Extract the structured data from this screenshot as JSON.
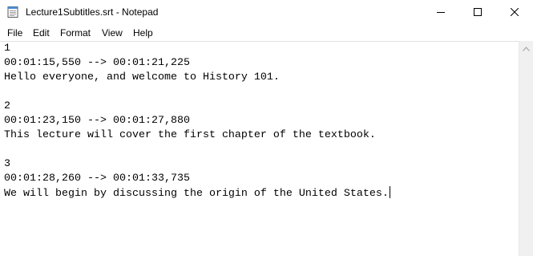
{
  "window": {
    "title": "Lecture1Subtitles.srt - Notepad"
  },
  "menu": {
    "file": "File",
    "edit": "Edit",
    "format": "Format",
    "view": "View",
    "help": "Help"
  },
  "document": {
    "lines": [
      "1",
      "00:01:15,550 --> 00:01:21,225",
      "Hello everyone, and welcome to History 101.",
      "",
      "2",
      "00:01:23,150 --> 00:01:27,880",
      "This lecture will cover the first chapter of the textbook.",
      "",
      "3",
      "00:01:28,260 --> 00:01:33,735",
      "We will begin by discussing the origin of the United States."
    ]
  },
  "icons": {
    "app": "notepad-icon",
    "minimize": "minimize-icon",
    "maximize": "maximize-icon",
    "close": "close-icon",
    "scroll_up": "chevron-up-icon"
  }
}
